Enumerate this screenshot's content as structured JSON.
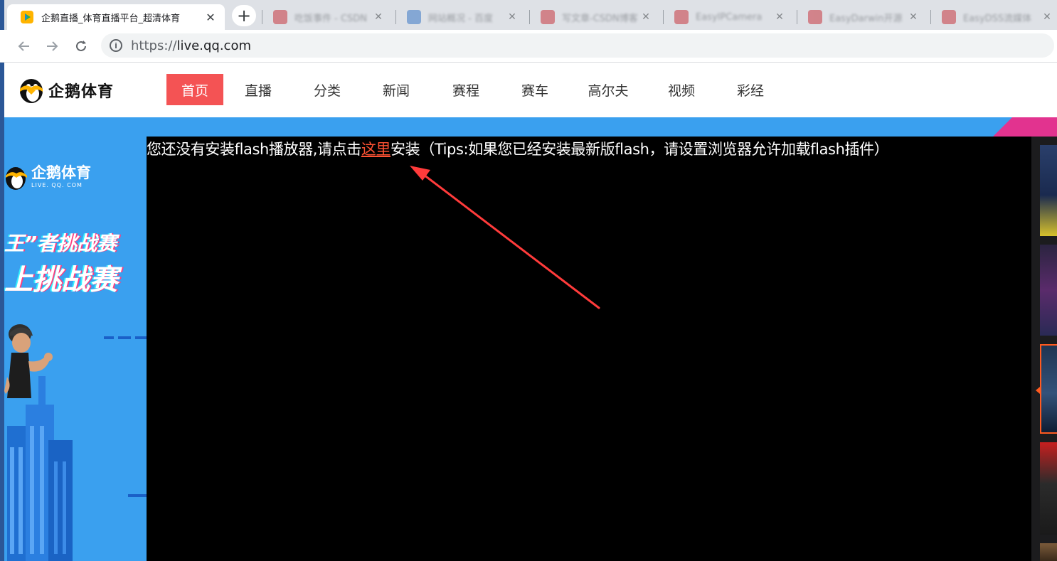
{
  "browser": {
    "active_tab": {
      "title": "企鹅直播_体育直播平台_超清体育"
    },
    "inactive_tabs": [
      {
        "title": "吃饭事件 - CSDN"
      },
      {
        "title": "网站概况 - 百度"
      },
      {
        "title": "写文章-CSDN博客"
      },
      {
        "title": "EasyIPCamera"
      },
      {
        "title": "EasyDarwin开源"
      },
      {
        "title": "EasyDSS流媒体"
      }
    ],
    "new_tab_label": "+",
    "close_glyph": "✕",
    "url_scheme": "https://",
    "url_host": "live.qq.com"
  },
  "site": {
    "logo_text": "企鹅体育",
    "nav": [
      {
        "label": "首页",
        "active": true
      },
      {
        "label": "直播",
        "active": false
      },
      {
        "label": "分类",
        "active": false
      },
      {
        "label": "新闻",
        "active": false
      },
      {
        "label": "赛程",
        "active": false
      },
      {
        "label": "赛车",
        "active": false
      },
      {
        "label": "高尔夫",
        "active": false
      },
      {
        "label": "视频",
        "active": false
      },
      {
        "label": "彩经",
        "active": false
      }
    ]
  },
  "promo": {
    "logo_text": "企鹅体育",
    "logo_sub": "LIVE. QQ. COM",
    "line1": "王”者挑战赛",
    "line2": "上挑战赛"
  },
  "player": {
    "message_before": "您还没有安装flash播放器,请点击",
    "message_link": "这里",
    "message_after": "安装（Tips:如果您已经安装最新版flash，请设置浏览器允许加载flash插件）"
  },
  "colors": {
    "nav_active": "#f45354",
    "hero_bg": "#3aa0ef",
    "link": "#ff5233",
    "annotation_arrow": "#ff3b3b"
  }
}
